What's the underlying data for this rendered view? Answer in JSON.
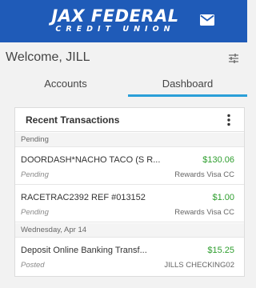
{
  "header": {
    "logo_line1": "JAX FEDERAL",
    "logo_line2": "CREDIT UNION",
    "mail_icon": "mail-icon",
    "brand_color": "#1f5bb8"
  },
  "welcome": {
    "text": "Welcome, JILL",
    "filter_icon": "sliders-icon"
  },
  "tabs": [
    {
      "label": "Accounts",
      "active": false
    },
    {
      "label": "Dashboard",
      "active": true
    }
  ],
  "accent_color": "#2a9fd8",
  "recent_transactions": {
    "title": "Recent Transactions",
    "menu_icon": "more-vertical-icon",
    "sections": [
      {
        "label": "Pending",
        "transactions": [
          {
            "name": "DOORDASH*NACHO TACO (S R...",
            "amount": "$130.06",
            "status": "Pending",
            "account": "Rewards Visa CC"
          },
          {
            "name": "RACETRAC2392 REF #013152",
            "amount": "$1.00",
            "status": "Pending",
            "account": "Rewards Visa CC"
          }
        ]
      },
      {
        "label": "Wednesday, Apr 14",
        "transactions": [
          {
            "name": "Deposit Online Banking Transf...",
            "amount": "$15.25",
            "status": "Posted",
            "account": "JILLS CHECKING02"
          }
        ]
      }
    ],
    "amount_color": "#2e9e2e"
  }
}
